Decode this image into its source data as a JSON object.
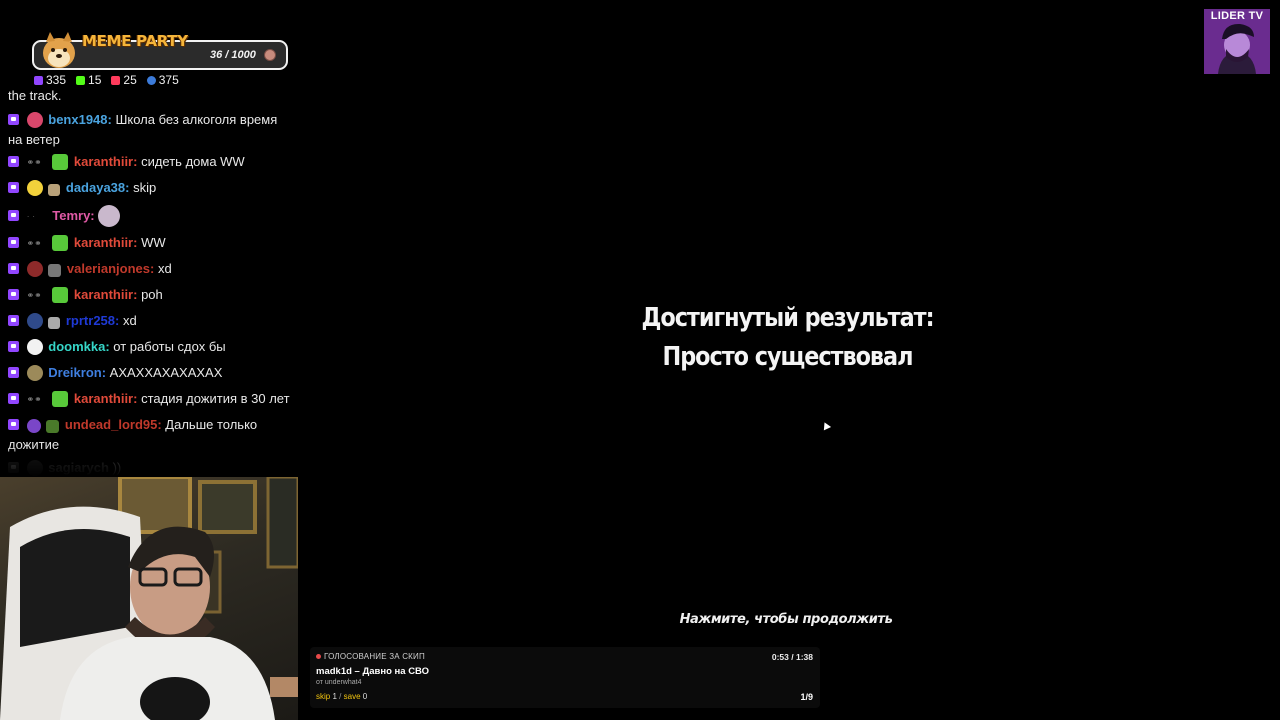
{
  "meme_party": {
    "title": "MEME PARTY",
    "progress": "36 / 1000",
    "progress_fraction": 0.036
  },
  "stats": [
    {
      "icon": "twitch-icon",
      "value": "335",
      "color": "#9146ff"
    },
    {
      "icon": "kick-icon",
      "value": "15",
      "color": "#53fc18"
    },
    {
      "icon": "vkplay-icon",
      "value": "25",
      "color": "#ff3b5c"
    },
    {
      "icon": "viewers-icon",
      "value": "375",
      "color": "#3c7bd9"
    }
  ],
  "chat": {
    "partial_top": "the track.",
    "messages": [
      {
        "user": "benx1948:",
        "user_color": "#4aa3df",
        "text": "Школа без алкоголя время на ветер"
      },
      {
        "user": "karanthiir:",
        "user_color": "#e04a3a",
        "text": "сидеть дома WW"
      },
      {
        "user": "dadaya38:",
        "user_color": "#4aa3df",
        "text": "skip"
      },
      {
        "user": "Temry:",
        "user_color": "#e05aa6",
        "text": ""
      },
      {
        "user": "karanthiir:",
        "user_color": "#e04a3a",
        "text": "WW"
      },
      {
        "user": "valerianjones:",
        "user_color": "#c0392b",
        "text": "xd"
      },
      {
        "user": "karanthiir:",
        "user_color": "#e04a3a",
        "text": "poh"
      },
      {
        "user": "rprtr258:",
        "user_color": "#1f3ad6",
        "text": "xd"
      },
      {
        "user": "doomkka:",
        "user_color": "#36d6c8",
        "text": "от работы сдох бы"
      },
      {
        "user": "Dreikron:",
        "user_color": "#3f7fe0",
        "text": "АХАХХАХАХАХАХ"
      },
      {
        "user": "karanthiir:",
        "user_color": "#e04a3a",
        "text": "стадия дожития в 30 лет"
      },
      {
        "user": "undead_lord95:",
        "user_color": "#c0392b",
        "text": "Дальше только дожитие"
      },
      {
        "user": "sagiarych",
        "user_color": "#888888",
        "text": "))"
      }
    ]
  },
  "logo": {
    "text": "LIDER TV"
  },
  "game": {
    "result_label": "Достигнутый результат:",
    "result_value": "Просто существовал",
    "continue_label": "Нажмите, чтобы продолжить"
  },
  "vote": {
    "header": "ГОЛОСОВАНИЕ ЗА СКИП",
    "time": "0:53 / 1:38",
    "track": "madk1d – Давно на СВО",
    "from": "от underwhat4",
    "skip_label": "skip",
    "skip_value": "1",
    "save_label": "save",
    "save_value": "0",
    "page": "1/9"
  }
}
